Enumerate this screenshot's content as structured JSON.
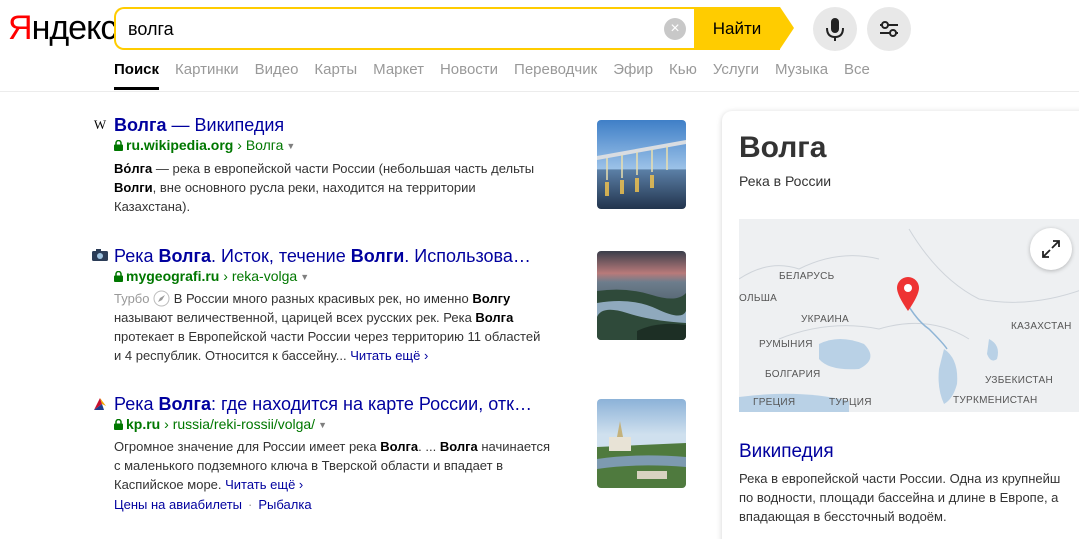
{
  "logo": {
    "first": "Я",
    "rest": "ндекс"
  },
  "search": {
    "query": "волга",
    "button": "Найти",
    "clear": "×"
  },
  "tabs": [
    "Поиск",
    "Картинки",
    "Видео",
    "Карты",
    "Маркет",
    "Новости",
    "Переводчик",
    "Эфир",
    "Кью",
    "Услуги",
    "Музыка",
    "Все"
  ],
  "results": [
    {
      "fav": "W",
      "title_b1": "Волга",
      "title_rest": " — Википедия",
      "domain": "ru.wikipedia.org",
      "crumb": "Волга",
      "t1b": "Во́лга",
      "t1": " — река в европейской части России (небольшая часть дельты",
      "t2b": "Волги",
      "t2": ", вне основного русла реки, находится на территории",
      "t3": "Казахстана)."
    },
    {
      "title_a": "Река ",
      "title_b1": "Волга",
      "title_m": ". Исток, течение ",
      "title_b2": "Волги",
      "title_rest": ". Использова…",
      "domain": "mygeografi.ru",
      "crumb": "reka-volga",
      "turbo": "Турбо",
      "t1": " В России много разных красивых рек, но именно ",
      "t1b": "Волгу",
      "t2": "называют величественной, царицей всех русских рек. Река ",
      "t2b": "Волга",
      "t3": "протекает в Европейской части России через территорию 11 областей",
      "t4": "и 4 республик. Относится к бассейну...",
      "more": "Читать ещё ›"
    },
    {
      "title_a": "Река ",
      "title_b1": "Волга",
      "title_rest": ": где находится на карте России, отк…",
      "domain": "kp.ru",
      "crumb": "russia/reki-rossii/volga/",
      "t1": "Огромное значение для России имеет река ",
      "t1b": "Волга",
      "t1c": ". ... ",
      "t1d": "Волга",
      "t1e": " начинается",
      "t2": "с маленького подземного ключа в Тверской области и впадает в",
      "t3": "Каспийское море. ",
      "more": "Читать ещё ›",
      "links": [
        "Цены на авиабилеты",
        "Рыбалка"
      ]
    }
  ],
  "card": {
    "title": "Волга",
    "subtitle": "Река в России",
    "map_labels": [
      "БЕЛАРУСЬ",
      "ОЛЬША",
      "УКРАИНА",
      "РУМЫНИЯ",
      "БОЛГАРИЯ",
      "ГРЕЦИЯ",
      "ТУРЦИЯ",
      "КАЗАХСТАН",
      "УЗБЕКИСТАН",
      "ТУРКМЕНИСТАН"
    ],
    "wiki_heading": "Википедия",
    "wiki_lines": [
      "Река в европейской части России. Одна из крупнейш",
      "по водности, площади бассейна и длине в Европе, а",
      "впадающая в бессточный водоём."
    ]
  },
  "colors": {
    "brand_red": "#ff0000",
    "accent": "#ffcc00",
    "link": "#00009e",
    "url": "#007700"
  },
  "icons": {
    "clear": "clear-icon",
    "mic": "microphone-icon",
    "filters": "sliders-icon",
    "expand": "expand-icon",
    "pin": "map-pin-icon"
  }
}
